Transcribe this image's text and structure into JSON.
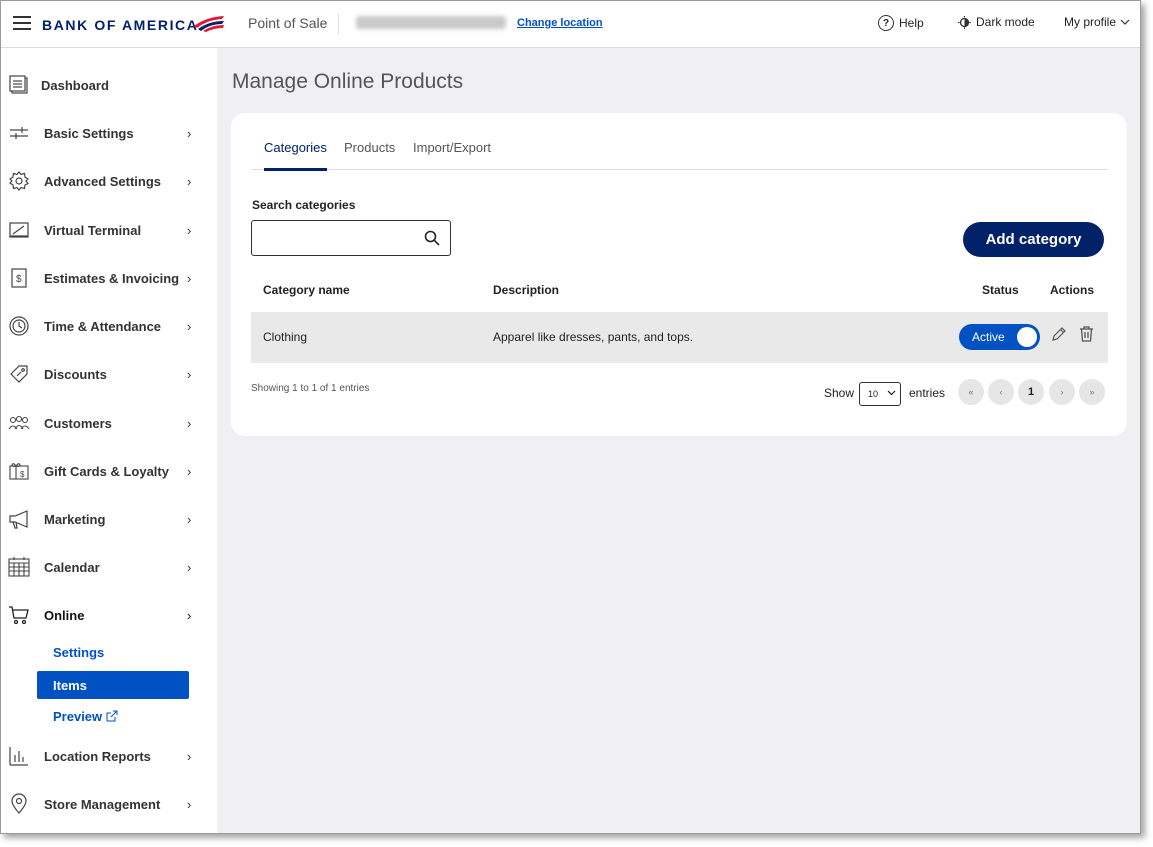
{
  "header": {
    "brand": "BANK OF AMERICA",
    "app": "Point of Sale",
    "change_location": "Change location",
    "help": "Help",
    "dark_mode": "Dark mode",
    "profile": "My profile"
  },
  "sidebar": {
    "items": [
      {
        "label": "Dashboard"
      },
      {
        "label": "Basic Settings"
      },
      {
        "label": "Advanced Settings"
      },
      {
        "label": "Virtual Terminal"
      },
      {
        "label": "Estimates & Invoicing"
      },
      {
        "label": "Time & Attendance"
      },
      {
        "label": "Discounts"
      },
      {
        "label": "Customers"
      },
      {
        "label": "Gift Cards & Loyalty"
      },
      {
        "label": "Marketing"
      },
      {
        "label": "Calendar"
      },
      {
        "label": "Online"
      },
      {
        "label": "Location Reports"
      },
      {
        "label": "Store Management"
      }
    ],
    "online_sub": [
      "Settings",
      "Items",
      "Preview"
    ]
  },
  "main": {
    "title": "Manage Online Products",
    "tabs": [
      "Categories",
      "Products",
      "Import/Export"
    ],
    "search_label": "Search categories",
    "search_value": "",
    "add_button": "Add category",
    "columns": [
      "Category name",
      "Description",
      "Status",
      "Actions"
    ],
    "rows": [
      {
        "name": "Clothing",
        "description": "Apparel like dresses, pants, and tops.",
        "status": "Active"
      }
    ],
    "showing": "Showing 1 to 1 of 1 entries",
    "show_label": "Show",
    "page_size": "10",
    "entries_label": "entries",
    "pagination": [
      "«",
      "‹",
      "1",
      "›",
      "»"
    ]
  },
  "colors": {
    "brand_navy": "#012169",
    "brand_red": "#e31837",
    "link_blue": "#0052c2",
    "main_bg": "#f0f0f2"
  }
}
